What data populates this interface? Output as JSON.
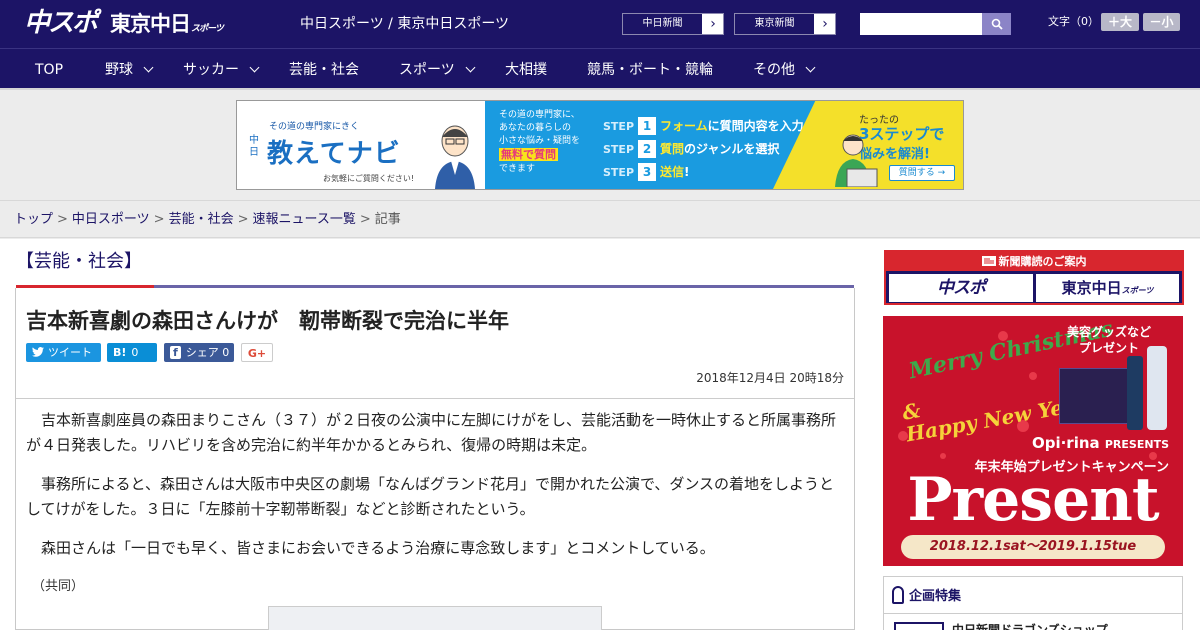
{
  "header": {
    "logo_chuspo": "中スポ",
    "logo_tokyo": "東京中日",
    "logo_tokyo_suffix": "スポーツ",
    "site_title": "中日スポーツ / 東京中日スポーツ",
    "ext_links": [
      {
        "label": "中日新聞",
        "arrow": "›"
      },
      {
        "label": "東京新聞",
        "arrow": "›"
      }
    ],
    "search_placeholder": "",
    "search_icon": "🔍",
    "font_size_label": "文字（0）",
    "font_bigger": "＋大",
    "font_smaller": "－小"
  },
  "nav": {
    "items": [
      {
        "label": "TOP",
        "has_menu": false
      },
      {
        "label": "野球",
        "has_menu": true
      },
      {
        "label": "サッカー",
        "has_menu": true
      },
      {
        "label": "芸能・社会",
        "has_menu": false
      },
      {
        "label": "スポーツ",
        "has_menu": true
      },
      {
        "label": "大相撲",
        "has_menu": false
      },
      {
        "label": "競馬・ボート・競輪",
        "has_menu": false
      },
      {
        "label": "その他",
        "has_menu": true
      }
    ]
  },
  "banner": {
    "subtitle": "その道の専門家にきく",
    "chunichi": "中日",
    "title": "教えてナビ",
    "note": "お気軽にご質問ください!",
    "mid_line1": "その道の専門家に、",
    "mid_line2": "あなたの暮らしの",
    "mid_line3": "小さな悩み・疑問を",
    "mid_highlight": "無料で質問",
    "mid_line4": "できます",
    "steps": [
      {
        "label": "STEP",
        "num": "1",
        "text_a": "フォーム",
        "text_b": "に質問内容を入力"
      },
      {
        "label": "STEP",
        "num": "2",
        "text_a": "質問",
        "text_b": "のジャンルを選択"
      },
      {
        "label": "STEP",
        "num": "3",
        "text_a": "送信",
        "text_b": "!"
      }
    ],
    "right_line1": "たったの",
    "right_line2": "3ステップで",
    "right_line3": "悩みを解消!",
    "right_button": "質問する →"
  },
  "breadcrumb": {
    "items": [
      "トップ",
      "中日スポーツ",
      "芸能・社会",
      "速報ニュース一覧"
    ],
    "current": "記事",
    "separator": ">"
  },
  "section": {
    "label": "【芸能・社会】"
  },
  "article": {
    "headline": "吉本新喜劇の森田さんけが　靭帯断裂で完治に半年",
    "share": {
      "tweet_icon": "🐦",
      "tweet_label": "ツイート",
      "hatena_icon": "B!",
      "hatena_count": "0",
      "fb_icon": "f",
      "fb_label": "シェア",
      "fb_count": "0",
      "gplus_label": "G+"
    },
    "date": "2018年12月4日 20時18分",
    "paragraphs": [
      "吉本新喜劇座員の森田まりこさん（３７）が２日夜の公演中に左脚にけがをし、芸能活動を一時休止すると所属事務所が４日発表した。リハビリを含め完治に約半年かかるとみられ、復帰の時期は未定。",
      "事務所によると、森田さんは大阪市中央区の劇場「なんばグランド花月」で開かれた公演で、ダンスの着地をしようとしてけがをした。３日に「左膝前十字靭帯断裂」などと診断されたという。",
      "森田さんは「一日でも早く、皆さまにお会いできるよう治療に専念致します」とコメントしている。"
    ],
    "credit": "（共同）"
  },
  "sidebar": {
    "subscribe_head": "新聞購読のご案内",
    "subscribe_logo_a": "中スポ",
    "subscribe_logo_b": "東京中日",
    "subscribe_logo_b_suffix": "スポーツ",
    "ad": {
      "merry": "Merry Christmas",
      "amp": "&",
      "happy": "Happy New Year",
      "goods_line1": "美容グッズなど",
      "goods_line2": "プレゼント",
      "brand": "Opi·rina",
      "brand_suffix": "PRESENTS",
      "campaign": "年末年始プレゼントキャンペーン",
      "present": "Present",
      "dates": "2018.12.1sat～2019.1.15tue"
    },
    "feature_head": "企画特集",
    "feature_item": "中日新聞ドラゴンズショップ"
  }
}
